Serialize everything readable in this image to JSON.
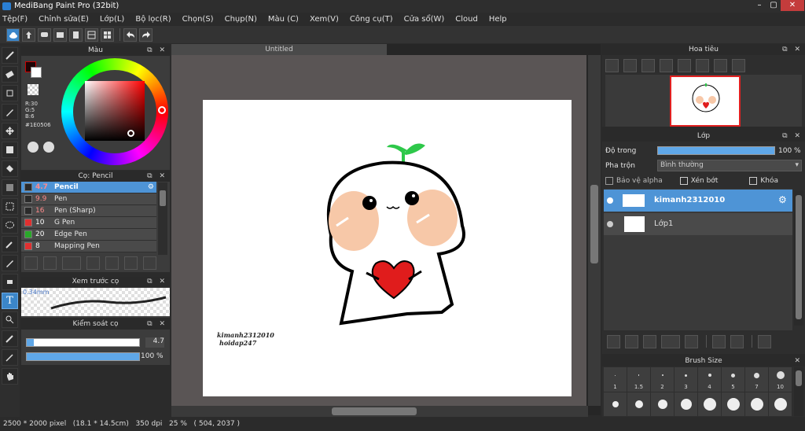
{
  "window": {
    "title": "MediBang Paint Pro (32bit)"
  },
  "menu": [
    "Tệp(F)",
    "Chỉnh sửa(E)",
    "Lớp(L)",
    "Bộ lọc(R)",
    "Chọn(S)",
    "Chụp(N)",
    "Màu (C)",
    "Xem(V)",
    "Công cụ(T)",
    "Cửa sổ(W)",
    "Cloud",
    "Help"
  ],
  "color_panel": {
    "title": "Màu",
    "r": "R:30",
    "g": "G:5",
    "b": "B:6",
    "hex": "#1E0506"
  },
  "brush_panel": {
    "title": "Cọ: Pencil",
    "items": [
      {
        "size": "4.7",
        "name": "Pencil",
        "color": "#2a2a2a"
      },
      {
        "size": "9.9",
        "name": "Pen",
        "color": "#2a2a2a"
      },
      {
        "size": "16",
        "name": "Pen (Sharp)",
        "color": "#2a2a2a"
      },
      {
        "size": "10",
        "name": "G Pen",
        "color": "#e03030"
      },
      {
        "size": "20",
        "name": "Edge Pen",
        "color": "#2aa82a"
      },
      {
        "size": "8",
        "name": "Mapping Pen",
        "color": "#e03030"
      }
    ]
  },
  "preview_panel": {
    "title": "Xem trước cọ",
    "size": "0.34mm"
  },
  "control_panel": {
    "title": "Kiểm soát cọ",
    "size_value": "4.7",
    "opacity_value": "100 %",
    "size_fraction": 0.06,
    "opacity_fraction": 1.0
  },
  "canvas": {
    "tab": "Untitled",
    "text1": "kimanh2312010",
    "text2": "hoidap247"
  },
  "navigator": {
    "title": "Hoa tiêu"
  },
  "layer_panel": {
    "title": "Lớp",
    "opacity_label": "Độ trong",
    "opacity_value": "100 %",
    "opacity_fraction": 1.0,
    "blend_label": "Pha trộn",
    "blend_value": "Bình thường",
    "protect_alpha": "Bảo vệ alpha",
    "clipping": "Xén bớt",
    "lock": "Khóa",
    "layers": [
      {
        "name": "kimanh2312010",
        "selected": true
      },
      {
        "name": "Lớp1",
        "selected": false
      }
    ]
  },
  "brush_size_panel": {
    "title": "Brush Size",
    "labels": [
      "1",
      "1.5",
      "2",
      "3",
      "4",
      "5",
      "7",
      "10"
    ]
  },
  "status": {
    "dimensions": "2500 * 2000 pixel",
    "physical": "(18.1 * 14.5cm)",
    "dpi": "350 dpi",
    "zoom": "25 %",
    "coords": "( 504, 2037 )"
  },
  "colors": {
    "accent": "#4e94d6",
    "primary_color": "#1E0506"
  }
}
